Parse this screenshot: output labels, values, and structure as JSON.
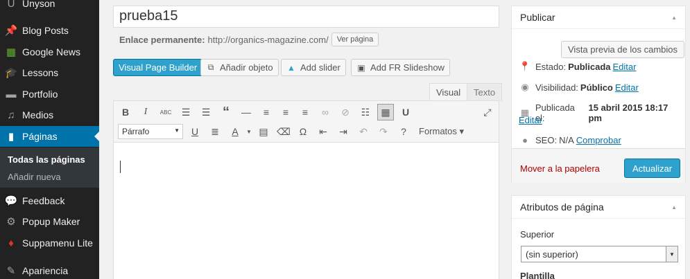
{
  "sidebar": {
    "items": [
      {
        "label": "Unyson",
        "icon": "unyson-icon"
      },
      {
        "label": "Blog Posts",
        "icon": "pin-icon"
      },
      {
        "label": "Google News",
        "icon": "google-news-icon"
      },
      {
        "label": "Lessons",
        "icon": "graduation-cap-icon"
      },
      {
        "label": "Portfolio",
        "icon": "folder-icon"
      },
      {
        "label": "Medios",
        "icon": "media-icon"
      },
      {
        "label": "Páginas",
        "icon": "pages-icon"
      },
      {
        "label": "Feedback",
        "icon": "comment-icon"
      },
      {
        "label": "Popup Maker",
        "icon": "popup-icon"
      },
      {
        "label": "Suppamenu Lite",
        "icon": "flame-icon"
      },
      {
        "label": "Apariencia",
        "icon": "brush-icon"
      }
    ],
    "submenu": [
      "Todas las páginas",
      "Añadir nueva"
    ]
  },
  "editor": {
    "title_value": "prueba15",
    "permalink_label": "Enlace permanente:",
    "permalink_url": "http://organics-magazine.com/",
    "view_page": "Ver página",
    "buttons": [
      "Visual Page Builder",
      "Añadir objeto",
      "Add slider",
      "Add FR Slideshow"
    ],
    "tabs": [
      "Visual",
      "Texto"
    ],
    "format_select": "Párrafo",
    "formats_menu": "Formatos"
  },
  "publish": {
    "title": "Publicar",
    "preview": "Vista previa de los cambios",
    "status_label": "Estado:",
    "status_value": "Publicada",
    "visibility_label": "Visibilidad:",
    "visibility_value": "Público",
    "published_label": "Publicada el:",
    "published_value": "15 abril 2015 18:17 pm",
    "edit": "Editar",
    "seo_label": "SEO:",
    "seo_value": "N/A",
    "seo_check": "Comprobar",
    "trash": "Mover a la papelera",
    "update": "Actualizar"
  },
  "attributes": {
    "title": "Atributos de página",
    "parent_label": "Superior",
    "parent_value": "(sin superior)",
    "template_label": "Plantilla"
  },
  "colors": {
    "accent": "#0073aa",
    "button_primary": "#2ea2cc",
    "sidebar_bg": "#222222"
  }
}
